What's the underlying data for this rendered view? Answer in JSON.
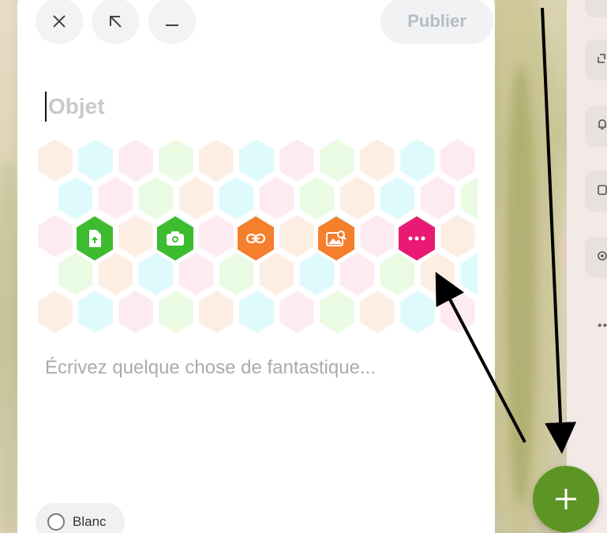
{
  "toolbar": {
    "close_icon": "close-icon",
    "expand_icon": "arrow-up-left-icon",
    "minimize_icon": "minimize-icon",
    "publish_label": "Publier"
  },
  "composer": {
    "subject_placeholder": "Objet",
    "body_placeholder": "Écrivez quelque chose de fantastique...",
    "tools": [
      {
        "name": "upload-file",
        "icon": "file-upload-icon",
        "color": "#3cbc2e"
      },
      {
        "name": "camera",
        "icon": "camera-icon",
        "color": "#3cbc2e"
      },
      {
        "name": "link",
        "icon": "link-icon",
        "color": "#f57f2c"
      },
      {
        "name": "image-search",
        "icon": "image-search-icon",
        "color": "#f57f2c"
      },
      {
        "name": "more",
        "icon": "more-dots-icon",
        "color": "#ea1a74"
      }
    ],
    "background_option": "Blanc"
  },
  "fab": {
    "icon": "plus-icon",
    "color": "#5d9524"
  },
  "right_panel": {
    "icons": [
      "recycle-icon",
      "bell-icon",
      "folder-icon",
      "gear-icon"
    ],
    "more": "••"
  }
}
